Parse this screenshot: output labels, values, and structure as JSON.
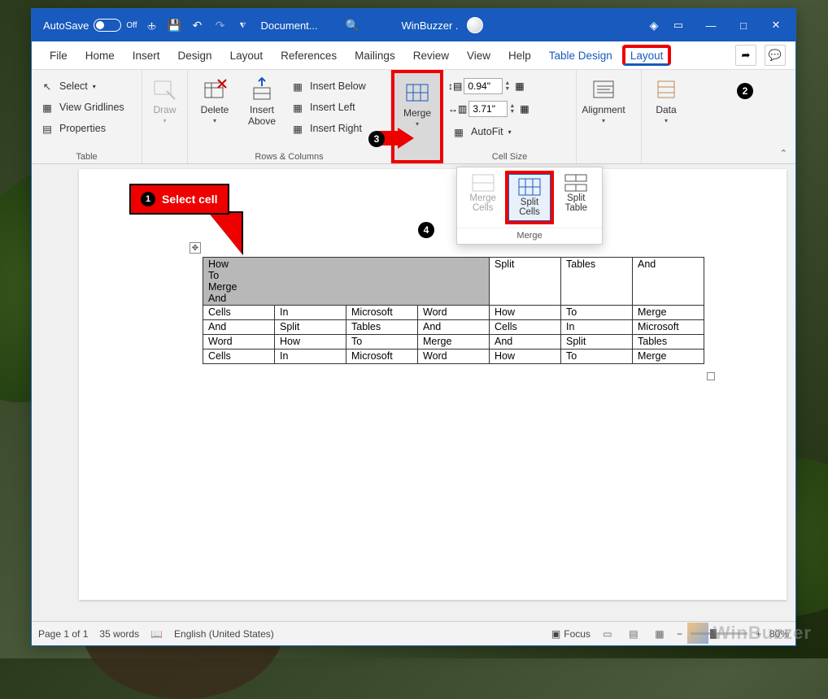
{
  "titlebar": {
    "autosave": "AutoSave",
    "autosave_state": "Off",
    "doc_title": "Document...",
    "user_name": "WinBuzzer ."
  },
  "tabs": {
    "file": "File",
    "home": "Home",
    "insert": "Insert",
    "design": "Design",
    "layout": "Layout",
    "references": "References",
    "mailings": "Mailings",
    "review": "Review",
    "view": "View",
    "help": "Help",
    "table_design": "Table Design",
    "table_layout": "Layout"
  },
  "ribbon": {
    "table_group": {
      "label": "Table",
      "select": "Select",
      "gridlines": "View Gridlines",
      "properties": "Properties"
    },
    "draw_group": {
      "draw": "Draw"
    },
    "rows_cols": {
      "label": "Rows & Columns",
      "delete": "Delete",
      "insert_above": "Insert Above",
      "insert_below": "Insert Below",
      "insert_left": "Insert Left",
      "insert_right": "Insert Right"
    },
    "merge": {
      "label": "Merge",
      "button": "Merge",
      "merge_cells": "Merge Cells",
      "split_cells": "Split Cells",
      "split_table": "Split Table",
      "dd_label": "Merge"
    },
    "cell_size": {
      "label": "Cell Size",
      "height": "0.94\"",
      "width": "3.71\"",
      "autofit": "AutoFit"
    },
    "alignment": {
      "label": "Alignment"
    },
    "data": {
      "label": "Data"
    }
  },
  "callouts": {
    "select_cell": "Select cell"
  },
  "table": {
    "merged_lines": [
      "How",
      "To",
      "Merge",
      "And"
    ],
    "row0_rest": [
      "Split",
      "Tables",
      "And"
    ],
    "rows": [
      [
        "Cells",
        "In",
        "Microsoft",
        "Word",
        "How",
        "To",
        "Merge"
      ],
      [
        "And",
        "Split",
        "Tables",
        "And",
        "Cells",
        "In",
        "Microsoft"
      ],
      [
        "Word",
        "How",
        "To",
        "Merge",
        "And",
        "Split",
        "Tables"
      ],
      [
        "Cells",
        "In",
        "Microsoft",
        "Word",
        "How",
        "To",
        "Merge"
      ]
    ]
  },
  "statusbar": {
    "page": "Page 1 of 1",
    "words": "35 words",
    "lang": "English (United States)",
    "focus": "Focus",
    "zoom": "80%"
  },
  "watermark": "WinBuzzer"
}
